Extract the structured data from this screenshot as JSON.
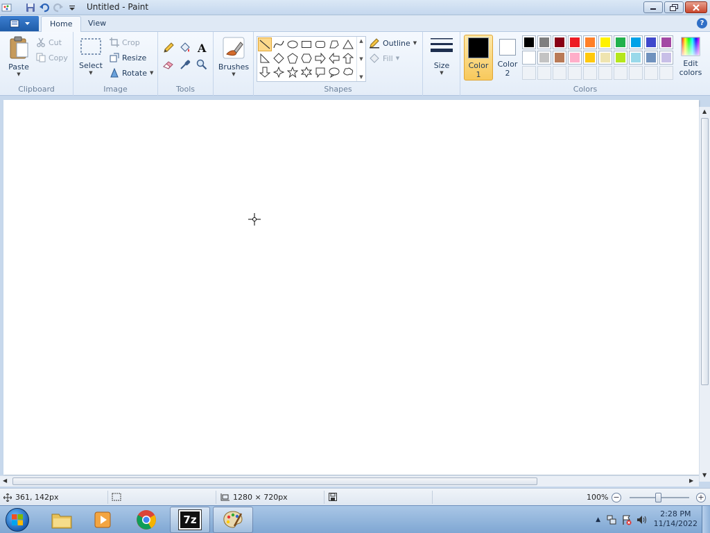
{
  "window": {
    "title": "Untitled - Paint"
  },
  "tabs": {
    "home": "Home",
    "view": "View"
  },
  "ribbon": {
    "clipboard": {
      "label": "Clipboard",
      "paste": "Paste",
      "cut": "Cut",
      "copy": "Copy"
    },
    "image": {
      "label": "Image",
      "select": "Select",
      "crop": "Crop",
      "resize": "Resize",
      "rotate": "Rotate"
    },
    "tools": {
      "label": "Tools"
    },
    "brushes": {
      "label": "Brushes"
    },
    "shapes": {
      "label": "Shapes",
      "outline": "Outline",
      "fill": "Fill"
    },
    "size": {
      "label": "Size"
    },
    "colors": {
      "label": "Colors",
      "color1_line1": "Color",
      "color1_line2": "1",
      "color2_line1": "Color",
      "color2_line2": "2",
      "edit_line1": "Edit",
      "edit_line2": "colors",
      "color1_value": "#000000",
      "color2_value": "#ffffff",
      "palette_row1": [
        "#000000",
        "#7f7f7f",
        "#880015",
        "#ed1c24",
        "#ff7f27",
        "#fff200",
        "#22b14c",
        "#00a2e8",
        "#3f48cc",
        "#a349a4"
      ],
      "palette_row2": [
        "#ffffff",
        "#c3c3c3",
        "#b97a57",
        "#ffaec9",
        "#ffc90e",
        "#efe4b0",
        "#b5e61d",
        "#99d9ea",
        "#7092be",
        "#c8bfe7"
      ],
      "custom_slots": 10
    }
  },
  "status": {
    "cursor_pos": "361, 142px",
    "image_size": "1280 × 720px",
    "zoom": "100%"
  },
  "taskbar": {
    "time": "2:28 PM",
    "date": "11/14/2022",
    "app_7zip": "7z"
  }
}
